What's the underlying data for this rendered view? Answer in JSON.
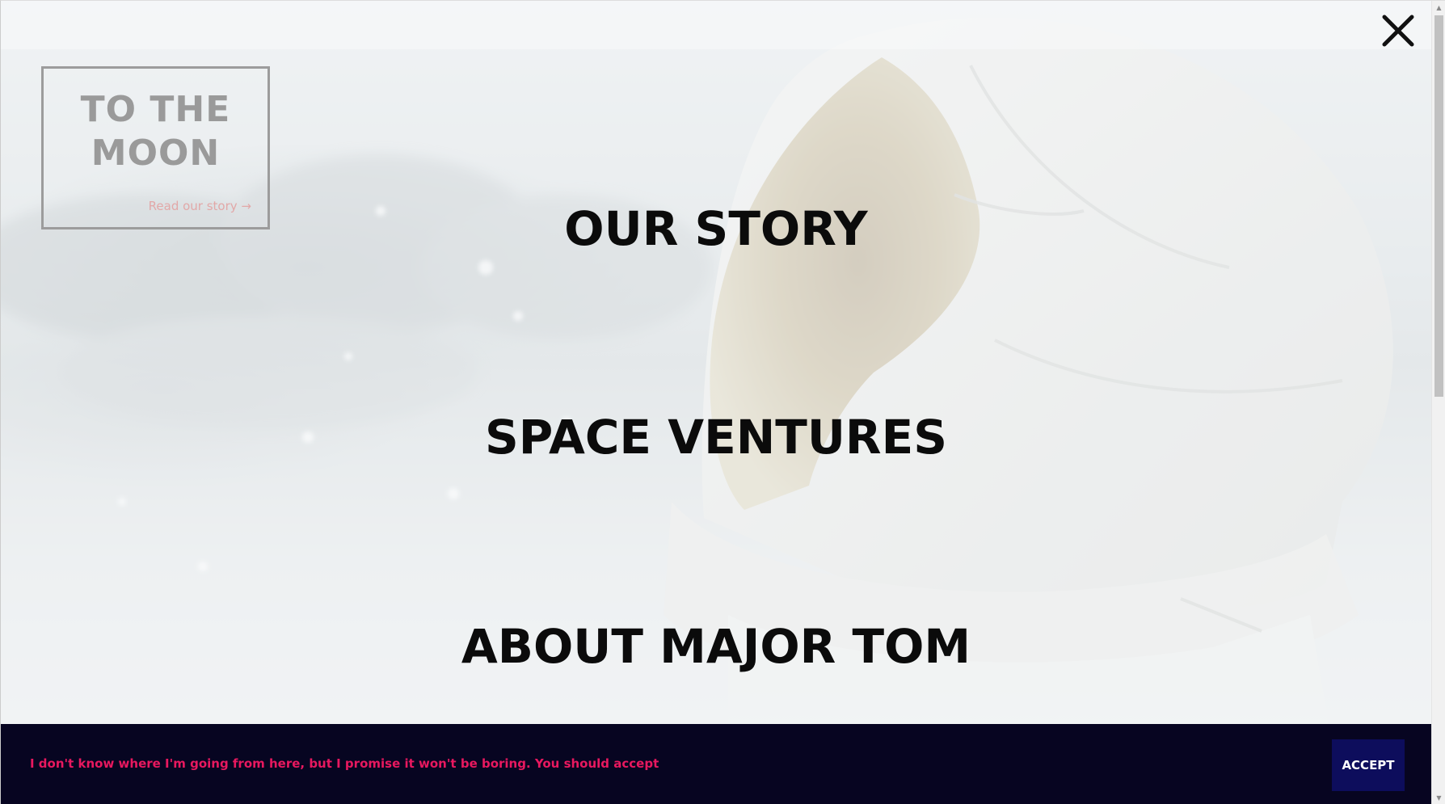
{
  "logo": {
    "title": "TO THE MOON",
    "link_label": "Read our story →"
  },
  "menu": {
    "items": [
      {
        "label": "OUR STORY"
      },
      {
        "label": "SPACE VENTURES"
      },
      {
        "label": "ABOUT MAJOR TOM"
      }
    ]
  },
  "close": {
    "icon": "close-icon"
  },
  "cookie": {
    "message": "I don't know where I'm going from here, but I promise it won't be boring. You should accept",
    "accept_label": "ACCEPT",
    "text_color": "#e8185f",
    "bar_color": "#070521",
    "button_color": "#0d0d5c"
  },
  "scrollbar": {
    "up_icon": "▲",
    "down_icon": "▼"
  }
}
